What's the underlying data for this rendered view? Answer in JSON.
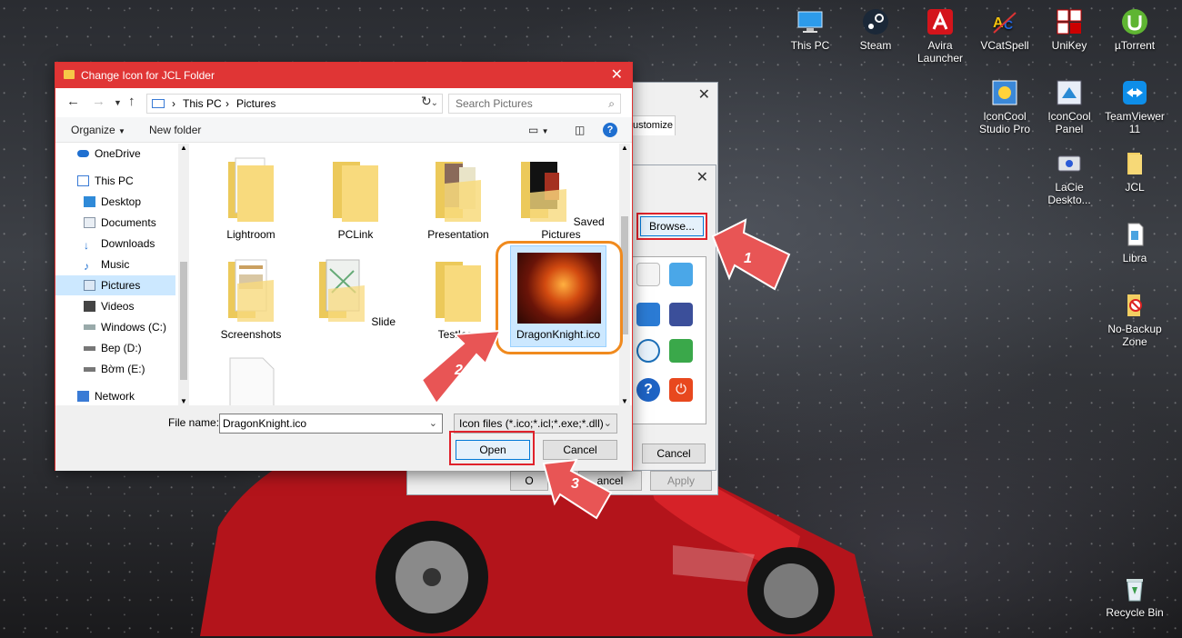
{
  "desktop": {
    "icons": [
      {
        "label": "This PC"
      },
      {
        "label": "Steam"
      },
      {
        "label": "Avira Launcher"
      },
      {
        "label": "VCatSpell"
      },
      {
        "label": "UniKey"
      },
      {
        "label": "µTorrent"
      },
      {
        "label": "IconCool Studio Pro"
      },
      {
        "label": "IconCool Panel"
      },
      {
        "label": "TeamViewer 11"
      },
      {
        "label": "LaCie Deskto..."
      },
      {
        "label": "JCL"
      },
      {
        "label": "Libra"
      },
      {
        "label": "No-Backup Zone"
      },
      {
        "label": "Recycle Bin"
      }
    ]
  },
  "properties_dialog": {
    "tab_label": "ustomize",
    "ok_label": "O",
    "cancel_label": "ancel",
    "apply_label": "Apply"
  },
  "change_icon_dialog": {
    "browse_label": "Browse...",
    "cancel_label": "Cancel"
  },
  "file_dialog": {
    "title": "Change Icon for JCL Folder",
    "breadcrumb": [
      "This PC",
      "Pictures"
    ],
    "breadcrumb_sep": "›",
    "search_placeholder": "Search Pictures",
    "toolbar": {
      "organize": "Organize",
      "new_folder": "New folder",
      "help": "?"
    },
    "nav_items": [
      {
        "label": "OneDrive"
      },
      {
        "label": "This PC"
      },
      {
        "label": "Desktop"
      },
      {
        "label": "Documents"
      },
      {
        "label": "Downloads"
      },
      {
        "label": "Music"
      },
      {
        "label": "Pictures"
      },
      {
        "label": "Videos"
      },
      {
        "label": "Windows (C:)"
      },
      {
        "label": "Bep (D:)"
      },
      {
        "label": "Bờm (E:)"
      },
      {
        "label": "Network"
      }
    ],
    "files": [
      {
        "label": "Lightroom"
      },
      {
        "label": "PCLink"
      },
      {
        "label": "Presentation"
      },
      {
        "label": "Saved Pictures"
      },
      {
        "label": "Screenshots"
      },
      {
        "label": "Slide"
      },
      {
        "label": "TestIcon"
      },
      {
        "label": "DragonKnight.ico"
      }
    ],
    "file_name_label": "File name:",
    "file_name_value": "DragonKnight.ico",
    "file_type": "Icon files (*.ico;*.icl;*.exe;*.dll)",
    "open_label": "Open",
    "cancel_label": "Cancel"
  },
  "annotations": [
    "1",
    "2",
    "3"
  ],
  "colors": {
    "title_bar": "#e03535",
    "highlight_orange": "#f08a1e",
    "highlight_red": "#e0222b",
    "selection": "#cce8ff"
  }
}
